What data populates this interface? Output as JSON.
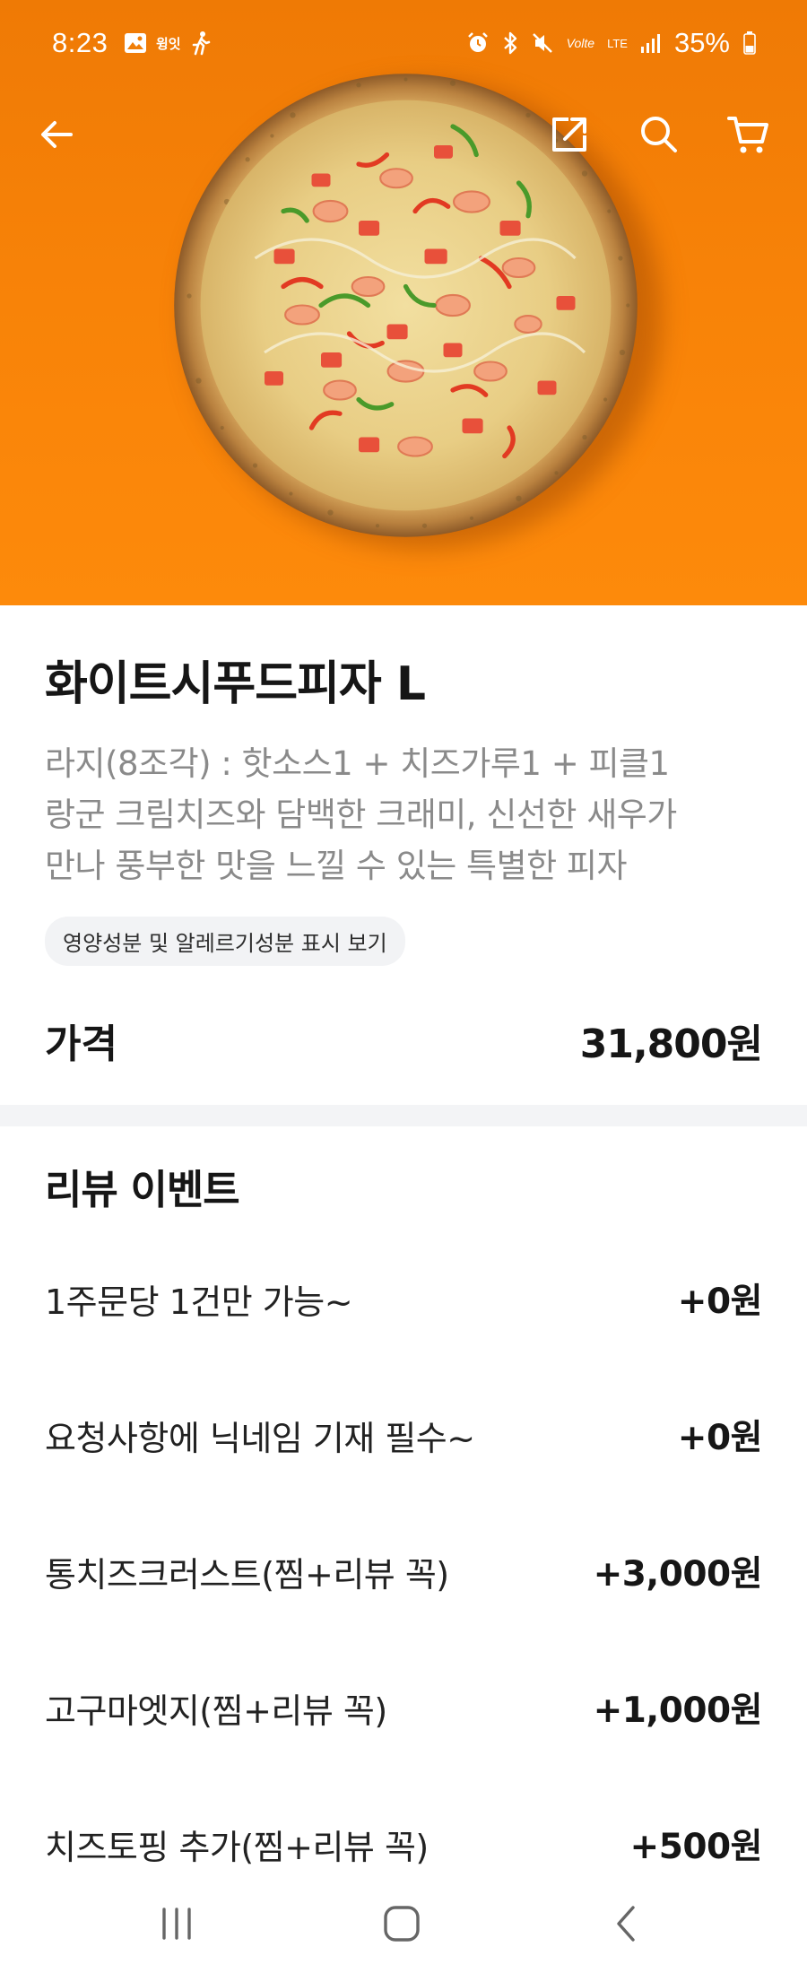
{
  "status_bar": {
    "time": "8:23",
    "app_label": "윙잇",
    "network": "Volte",
    "lte": "LTE",
    "battery": "35%"
  },
  "nav": {
    "icons": [
      "back-arrow-icon",
      "share-icon",
      "search-icon",
      "cart-icon"
    ]
  },
  "hero": {
    "image": "pizza-photo",
    "background_color": "#fb8709"
  },
  "product": {
    "title": "화이트시푸드피자 L",
    "description": [
      "라지(8조각) : 핫소스1 + 치즈가루1 + 피클1",
      "랑군 크림치즈와 담백한 크래미, 신선한 새우가",
      "만나 풍부한 맛을 느낄 수 있는 특별한 피자"
    ],
    "nutrition_link": "영양성분 및 알레르기성분 표시 보기"
  },
  "price": {
    "label": "가격",
    "value": "31,800원"
  },
  "review_event": {
    "title": "리뷰 이벤트",
    "options": [
      {
        "name": "1주문당 1건만 가능~",
        "price": "+0원"
      },
      {
        "name": "요청사항에 닉네임 기재 필수~",
        "price": "+0원"
      },
      {
        "name": "통치즈크러스트(찜+리뷰 꼭)",
        "price": "+3,000원"
      },
      {
        "name": "고구마엣지(찜+리뷰 꼭)",
        "price": "+1,000원"
      },
      {
        "name": "치즈토핑 추가(찜+리뷰 꼭)",
        "price": "+500원"
      }
    ]
  },
  "system_nav": {
    "icons": [
      "recent-apps-icon",
      "home-icon",
      "system-back-icon"
    ]
  }
}
